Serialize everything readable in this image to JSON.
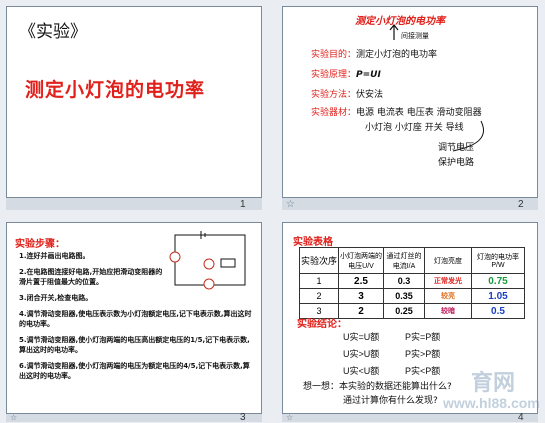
{
  "slides": [
    {
      "number": "1",
      "heading": "《实验》",
      "title": "测定小灯泡的电功率"
    },
    {
      "number": "2",
      "marker": "☆",
      "title": "测定小灯泡的电功率",
      "subtitle": "间接测量",
      "purpose_label": "实验目的：",
      "purpose_value": "测定小灯泡的电功率",
      "principle_label": "实验原理：",
      "principle_value": "P=UI",
      "method_label": "实验方法：",
      "method_value": "伏安法",
      "equipment_label": "实验器材：",
      "equipment_line1": "电源 电流表 电压表 滑动变阻器",
      "equipment_line2": "小灯泡 小灯座 开关 导线",
      "note_line1": "调节电压",
      "note_line2": "保护电路"
    },
    {
      "number": "3",
      "marker": "☆",
      "title": "实验步骤：",
      "steps": [
        "1.连好并画出电路图。",
        "2.在电路图连接好电路,开始应把滑动变阻器的滑片置于阻值最大的位置。",
        "3.闭合开关,检查电路。",
        "4.调节滑动变阻器,使电压表示数为小灯泡额定电压,记下电表示数,算出这时的电功率。",
        "5.调节滑动变阻器,使小灯泡两端的电压高出额定电压的1/5,记下电表示数,算出这时的电功率。",
        "6.调节滑动变阻器,使小灯泡两端的电压为额定电压的4/5,记下电表示数,算出这时的电功率。"
      ]
    },
    {
      "number": "4",
      "marker": "☆",
      "table_title": "实验表格",
      "headers": [
        "实验次序",
        "小灯泡两端的电压U/V",
        "通过灯丝的电流I/A",
        "灯泡亮度",
        "灯泡的电功率P/W"
      ],
      "rows": [
        {
          "n": "1",
          "u": "2.5",
          "i": "0.3",
          "b": "正常发光",
          "p": "0.75"
        },
        {
          "n": "2",
          "u": "3",
          "i": "0.35",
          "b": "较亮",
          "p": "1.05"
        },
        {
          "n": "3",
          "u": "2",
          "i": "0.25",
          "b": "较暗",
          "p": "0.5"
        }
      ],
      "conclusion_title": "实验结论：",
      "conclusions": [
        {
          "u": "U实=U额",
          "p": "P实=P额"
        },
        {
          "u": "U实>U额",
          "p": "P实>P额"
        },
        {
          "u": "U实<U额",
          "p": "P实<P额"
        }
      ],
      "think_line1": "想一想：本实验的数据还能算出什么?",
      "think_line2": "通过计算你有什么发现?",
      "watermark_logo": "育网",
      "watermark_url": "www.hl88.com"
    }
  ],
  "colors": {
    "accent_red": "#e0201a",
    "accent_blue": "#1a40c0",
    "accent_green": "#1a9a3a",
    "accent_orange": "#e07020"
  }
}
